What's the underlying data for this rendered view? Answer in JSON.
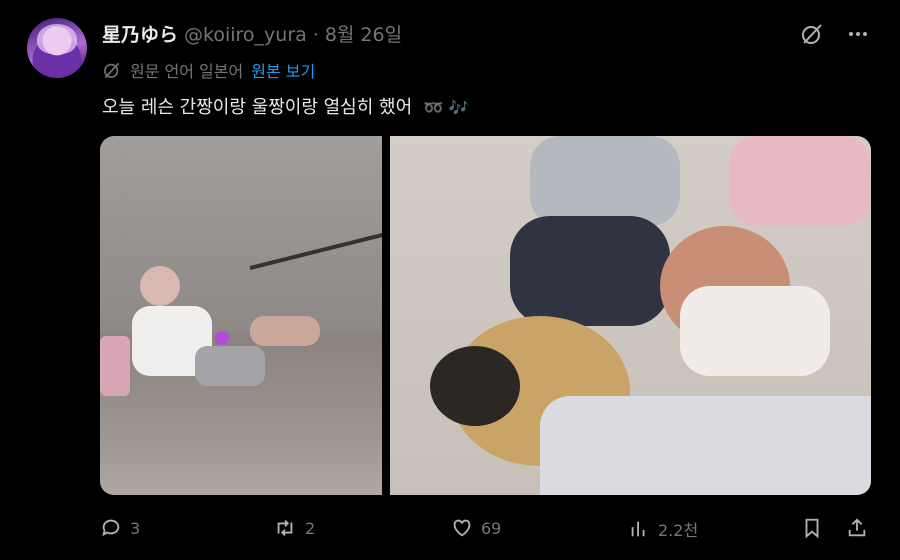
{
  "author": {
    "display_name": "星乃ゆら",
    "handle": "@koiiro_yura",
    "separator": "·",
    "date": "8월 26일"
  },
  "translation": {
    "label": "원문 언어 일본어",
    "view_original": "원본 보기"
  },
  "tweet": {
    "text": "오늘 레슨 간짱이랑 울짱이랑 열심히 했어",
    "emoji": "➿ 🎶"
  },
  "media": {
    "count": 2
  },
  "actions": {
    "replies": "3",
    "reposts": "2",
    "likes": "69",
    "views": "2.2천"
  },
  "colors": {
    "background": "#000000",
    "text": "#e7e9ea",
    "muted": "#71767b",
    "link": "#1d9bf0"
  },
  "icons": [
    "grok-icon",
    "more-icon",
    "translate-icon",
    "reply-icon",
    "repost-icon",
    "like-icon",
    "views-icon",
    "bookmark-icon",
    "share-icon"
  ]
}
